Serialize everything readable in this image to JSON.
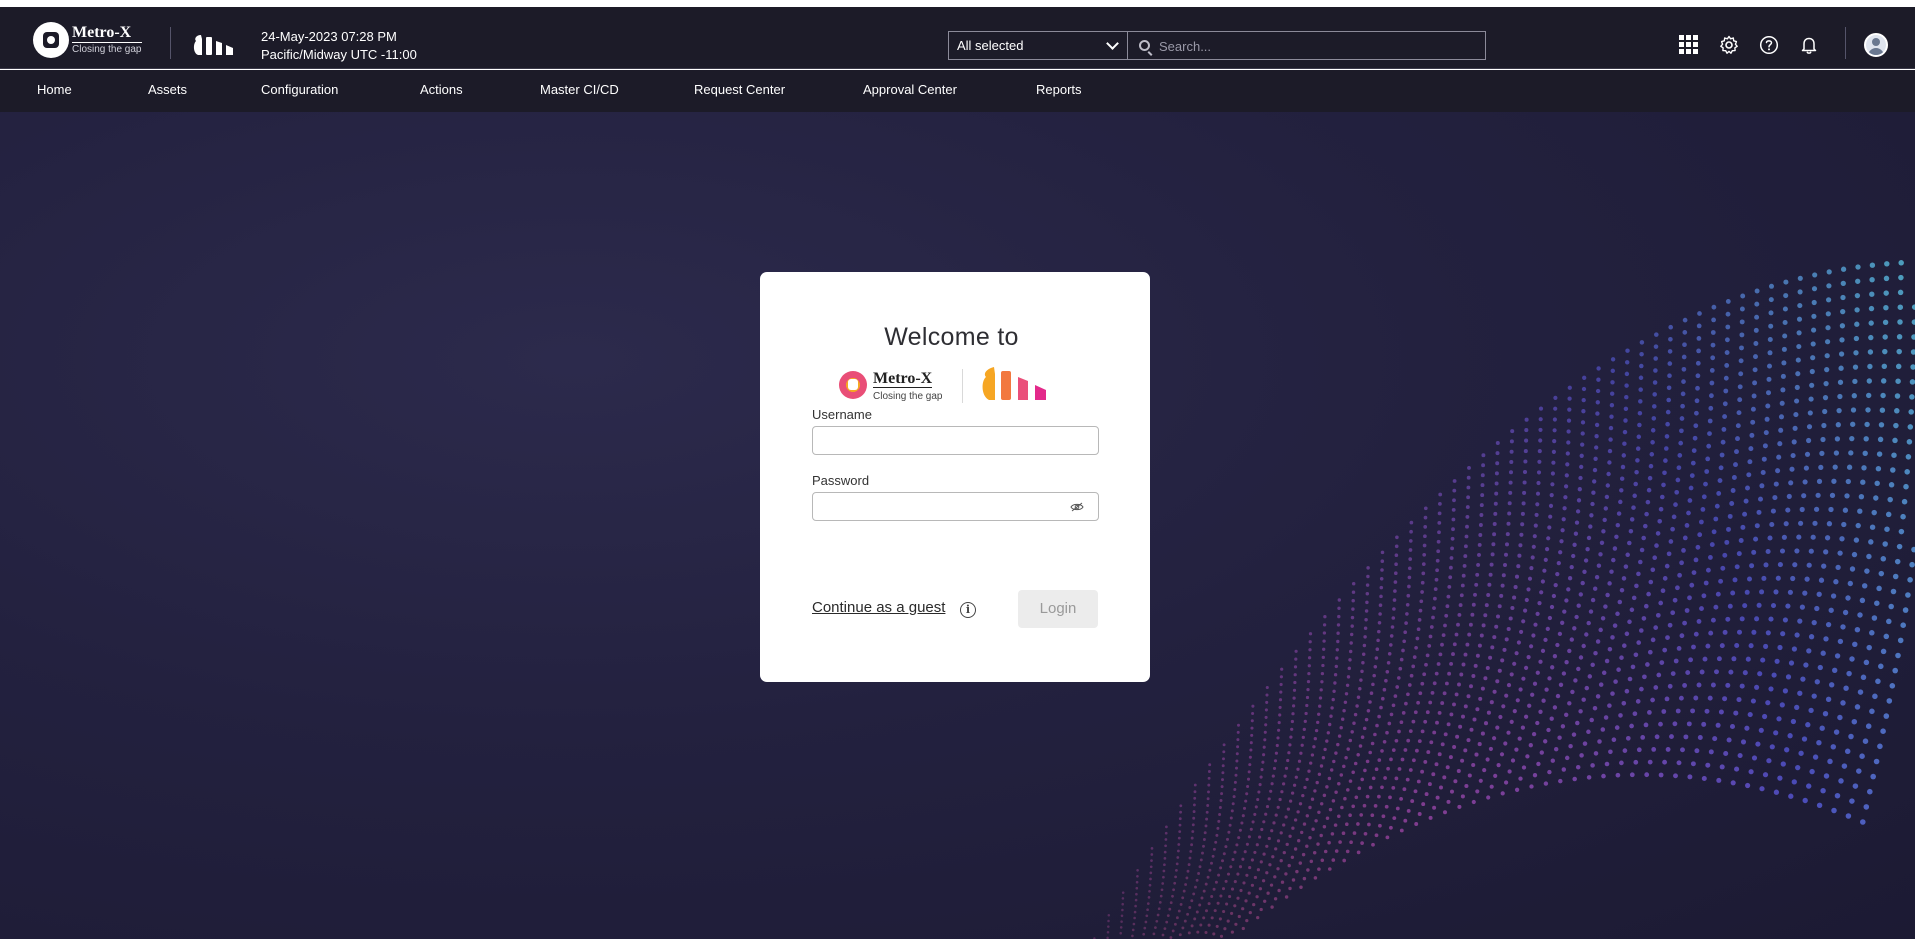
{
  "header": {
    "brand_name": "Metro-X",
    "brand_tagline": "Closing the gap",
    "datetime": "24-May-2023 07:28 PM",
    "timezone": "Pacific/Midway UTC -11:00",
    "scope_select": "All selected",
    "search_placeholder": "Search...",
    "icons": [
      "apps-grid-icon",
      "gear-icon",
      "help-icon",
      "bell-icon",
      "avatar"
    ]
  },
  "nav": {
    "items": [
      "Home",
      "Assets",
      "Configuration",
      "Actions",
      "Master CI/CD",
      "Request Center",
      "Approval Center",
      "Reports"
    ]
  },
  "login": {
    "welcome": "Welcome to",
    "brand_name": "Metro-X",
    "brand_tagline": "Closing the gap",
    "username_label": "Username",
    "password_label": "Password",
    "username_value": "",
    "password_value": "",
    "guest_link": "Continue as a guest",
    "login_button": "Login"
  },
  "colors": {
    "header_bg": "#1c1b28",
    "main_bg": "#23213f",
    "card_bg": "#ffffff",
    "disabled_button_bg": "#ececec",
    "brand_orange": "#f6a623",
    "brand_pink": "#e94e77"
  }
}
